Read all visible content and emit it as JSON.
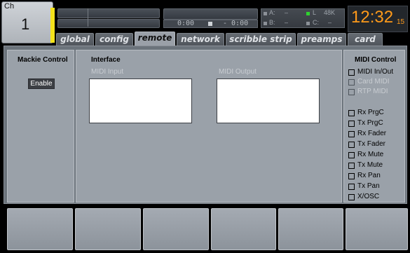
{
  "channel": {
    "label": "Ch",
    "number": "1"
  },
  "transport": {
    "time_left": "0:00",
    "time_right": "- 0:00"
  },
  "meters": {
    "a_label": "A:",
    "a_value": "–",
    "b_label": "B:",
    "b_value": "–",
    "l_label": "L",
    "l_value": "48K",
    "c_label": "C:",
    "c_value": "–"
  },
  "clock": {
    "time": "12:32",
    "seconds": "15"
  },
  "tabs": [
    {
      "label": "global"
    },
    {
      "label": "config"
    },
    {
      "label": "remote",
      "active": true
    },
    {
      "label": "network"
    },
    {
      "label": "scribble strip"
    },
    {
      "label": "preamps"
    },
    {
      "label": "card"
    }
  ],
  "mackie": {
    "title": "Mackie Control",
    "enable_label": "Enable"
  },
  "interface": {
    "title": "Interface",
    "midi_input_label": "MIDI Input",
    "midi_output_label": "MIDI Output"
  },
  "midi_control": {
    "title": "MIDI Control",
    "items": [
      {
        "label": "MIDI In/Out",
        "enabled": true
      },
      {
        "label": "Card MIDI",
        "enabled": false
      },
      {
        "label": "RTP MIDI",
        "enabled": false
      },
      {
        "label": "Rx PrgC",
        "enabled": true
      },
      {
        "label": "Tx PrgC",
        "enabled": true
      },
      {
        "label": "Rx Fader",
        "enabled": true
      },
      {
        "label": "Tx Fader",
        "enabled": true
      },
      {
        "label": "Rx Mute",
        "enabled": true
      },
      {
        "label": "Tx Mute",
        "enabled": true
      },
      {
        "label": "Rx Pan",
        "enabled": true
      },
      {
        "label": "Tx Pan",
        "enabled": true
      },
      {
        "label": "X/OSC",
        "enabled": true
      }
    ]
  },
  "colors": {
    "clock": "#ff9a1a",
    "channel_strip": "#f4e21b",
    "meter_active": "#2fd12f"
  }
}
